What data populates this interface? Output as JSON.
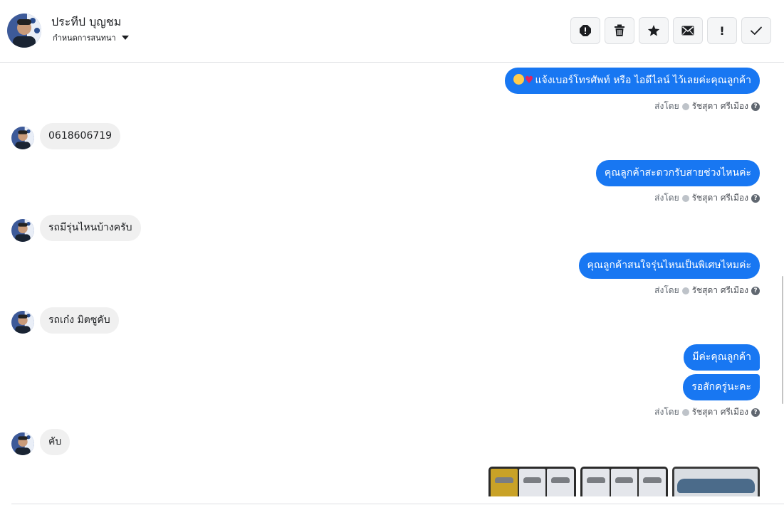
{
  "header": {
    "contact_name": "ประทีป บุญชม",
    "assign_label": "กำหนดการสนทนา"
  },
  "toolbar": {
    "buttons": [
      {
        "icon": "spam-icon"
      },
      {
        "icon": "trash-icon"
      },
      {
        "icon": "star-icon"
      },
      {
        "icon": "envelope-icon"
      },
      {
        "icon": "exclamation-icon",
        "glyph": "!"
      },
      {
        "icon": "check-icon"
      }
    ]
  },
  "messages": {
    "m1": "แจ้งเบอร์โทรศัพท์ หรือ ไอดีไลน์  ไว้เลยค่ะคุณลูกค้า",
    "m2": "0618606719",
    "m3": "คุณลูกค้าสะดวกรับสายช่วงไหนค่ะ",
    "m4": "รถมีรุ่นไหนบ้างครับ",
    "m5": "คุณลูกค้าสนใจรุ่นไหนเป็นพิเศษไหมค่ะ",
    "m6": "รถเก๋ง มิตซูคับ",
    "m7": "มีค่ะคุณลูกค้า",
    "m8": "รอสักครู่นะคะ",
    "m9": "คับ"
  },
  "sent_by": {
    "prefix": "ส่งโดย",
    "agent": "รัชสุดา ศรีเมือง",
    "help": "?"
  },
  "colors": {
    "outgoing": "#1877f2",
    "incoming": "#f0f0f0",
    "accent": "#1877f2"
  }
}
